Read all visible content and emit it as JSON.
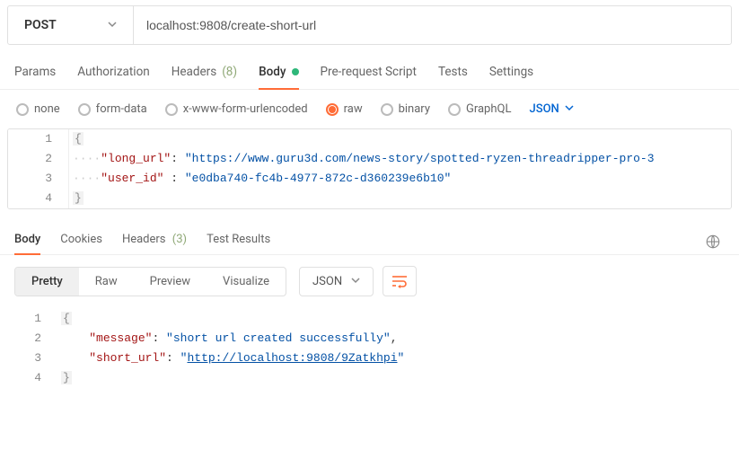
{
  "request": {
    "method": "POST",
    "url": "localhost:9808/create-short-url"
  },
  "tabs": {
    "params": "Params",
    "authorization": "Authorization",
    "headers": "Headers",
    "headers_count": "(8)",
    "body": "Body",
    "prerequest": "Pre-request Script",
    "tests": "Tests",
    "settings": "Settings"
  },
  "body_types": {
    "none": "none",
    "form_data": "form-data",
    "xwww": "x-www-form-urlencoded",
    "raw": "raw",
    "binary": "binary",
    "graphql": "GraphQL",
    "format": "JSON"
  },
  "request_body": {
    "lines": [
      "1",
      "2",
      "3",
      "4"
    ],
    "l2_key": "\"long_url\"",
    "l2_val": "\"https://www.guru3d.com/news-story/spotted-ryzen-threadripper-pro-3",
    "l3_key": "\"user_id\"",
    "l3_val": "\"e0dba740-fc4b-4977-872c-d360239e6b10\""
  },
  "response_tabs": {
    "body": "Body",
    "cookies": "Cookies",
    "headers": "Headers",
    "headers_count": "(3)",
    "test_results": "Test Results"
  },
  "view_modes": {
    "pretty": "Pretty",
    "raw": "Raw",
    "preview": "Preview",
    "visualize": "Visualize",
    "format": "JSON"
  },
  "response_body": {
    "lines": [
      "1",
      "2",
      "3",
      "4"
    ],
    "l2_key": "\"message\"",
    "l2_val": "\"short url created successfully\"",
    "l3_key": "\"short_url\"",
    "l3_prefix": "\"",
    "l3_link": "http://localhost:9808/9Zatkhpi",
    "l3_suffix": "\""
  }
}
